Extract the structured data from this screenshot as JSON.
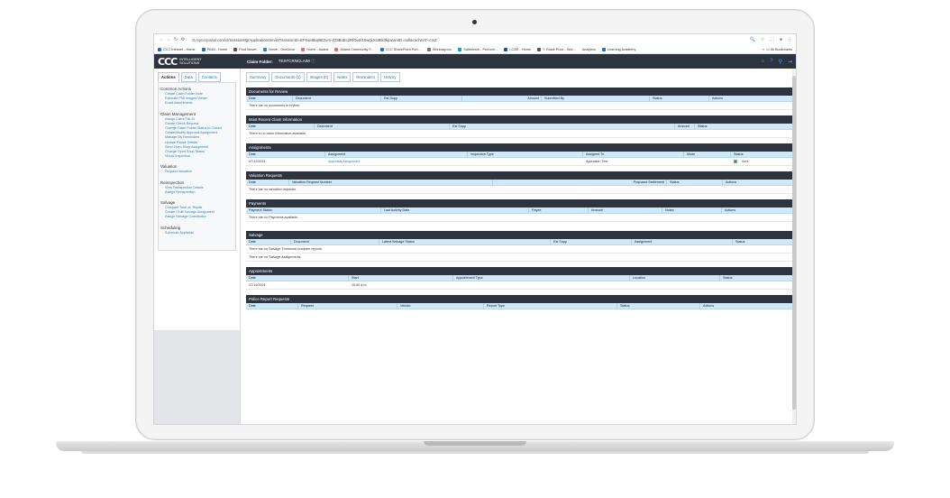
{
  "browser": {
    "url": "ct.mycccportal.com/ct/SessionMgrApplicationServlet?sessionID=EPSw49ap9E2vm-ZZ5BoBc2RfOu3GSwqkXUBtkrlkparamID=null&cacheAT=cmZ",
    "bookmarks": [
      "CCC Intranet - Home",
      "PAIM - Home",
      "Prod Mover",
      "Home - OneDrive",
      "Home - Asana",
      "Asana Community F...",
      "CCC SharePoint Port...",
      "Workday.ccc",
      "Salesforce - Perform...",
      "I-CAR - Home",
      "T. Rowe Price - Wor...",
      "Analytics",
      "Learning Academy"
    ],
    "all_bookmarks": "All Bookmarks"
  },
  "header": {
    "logo_mark": "CCC",
    "logo_line1": "INTELLIGENT",
    "logo_line2": "SOLUTIONS",
    "claim_label": "Claim Folder:",
    "claim_value": "TESTCRNCLAIM"
  },
  "sidebar": {
    "tabs": [
      "Actions",
      "Data",
      "Contacts"
    ],
    "groups": [
      {
        "title": "Common Actions",
        "items": [
          "Create Claim Folder Note",
          "Estimate PMI Images Viewer",
          "Email Attachments"
        ]
      },
      {
        "title": "Claim Management",
        "items": [
          "Assign Client File ID",
          "Create Check Request",
          "Change Claim Folder Status to Closed",
          "Create/Modify Approval Assignment",
          "Manage My Reminders",
          "Update Repair Details",
          "Send Open Shop Assignment",
          "Change Open Shop Status",
          "Virtual Inspection"
        ]
      },
      {
        "title": "Valuation",
        "items": [
          "Request Valuation"
        ]
      },
      {
        "title": "Reinspection",
        "items": [
          "View Reinspection Details",
          "Assign Reinspection"
        ]
      },
      {
        "title": "Salvage",
        "items": [
          "Compare Total vs. Repair",
          "Create / Edit Salvage Assignment",
          "Assign Salvage Coordinator"
        ]
      },
      {
        "title": "Scheduling",
        "items": [
          "Schedule Appraisal"
        ]
      }
    ]
  },
  "main": {
    "tabs": [
      "Summary",
      "Documents (1)",
      "Images (0)",
      "Notes",
      "Reminders",
      "History"
    ],
    "documents": {
      "title": "Documents for Review",
      "columns": [
        "Date",
        "Document",
        "Est Supp",
        "Amount",
        "Submitted By",
        "Status",
        "Actions"
      ],
      "message": "There are no documents to review."
    },
    "claim_info": {
      "title": "Most Recent Claim Information",
      "columns": [
        "Date",
        "Document",
        "Est Supp",
        "Amount",
        "Status"
      ],
      "message": "There is no claim information available."
    },
    "assignments": {
      "title": "Assignments",
      "columns": [
        "Date",
        "Assignment",
        "Inspection Type",
        "Assigned To",
        "Mode",
        "Status"
      ],
      "rows": [
        {
          "date": "07/12/2024",
          "assignment": "Appraisal Assignment",
          "inspection_type": "",
          "assigned_to": "Appraiser, Test",
          "mode": "",
          "status": "Sent"
        }
      ]
    },
    "valuation": {
      "title": "Valuation Requests",
      "columns": [
        "Date",
        "Valuation Request Number",
        "Proposed Settlement",
        "Status",
        "Actions"
      ],
      "message": "There are no valuation requests."
    },
    "payments": {
      "title": "Payments",
      "columns": [
        "Payment Status",
        "Last Activity Date",
        "Payee",
        "Amount",
        "Notes",
        "Actions"
      ],
      "message": "There are no Payments available."
    },
    "salvage": {
      "title": "Salvage",
      "columns": [
        "Date",
        "Document",
        "Latest Salvage Status",
        "Est Supp",
        "Assignment",
        "Status"
      ],
      "message1": "There are no Salvage Threshold compare reports.",
      "message2": "There are no Salvage Assignments."
    },
    "appointments": {
      "title": "Appointments",
      "columns": [
        "Date",
        "Start",
        "Appointment Type",
        "Location",
        "Status"
      ],
      "rows": [
        {
          "date": "07/14/2024",
          "start": "10:00 a.m."
        }
      ]
    },
    "police": {
      "title": "Police Report Requests",
      "columns": [
        "Date",
        "Request",
        "Vendor",
        "Report Type",
        "Status",
        "Actions"
      ]
    }
  }
}
